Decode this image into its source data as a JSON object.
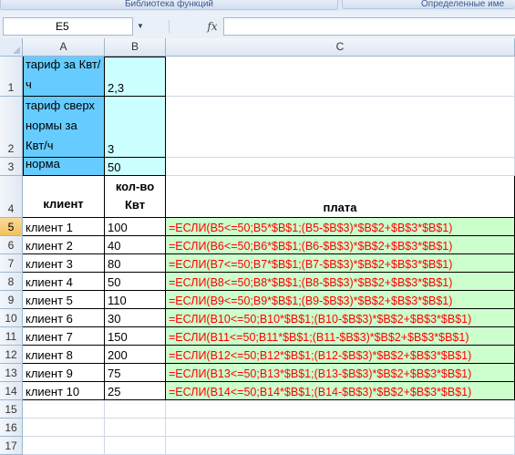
{
  "ribbon": {
    "group1_label": "Библиотека функций",
    "group2_label": "Определенные име"
  },
  "formula_bar": {
    "name_box": "E5",
    "fx_label": "fx",
    "formula_value": ""
  },
  "columns": [
    "A",
    "B",
    "C"
  ],
  "rows": [
    {
      "num": "1",
      "a": "тариф за Квт/ч",
      "b": "2,3",
      "c": ""
    },
    {
      "num": "2",
      "a": "тариф сверх нормы за Квт/ч",
      "b": "3",
      "c": ""
    },
    {
      "num": "3",
      "a": "норма",
      "b": "50",
      "c": ""
    },
    {
      "num": "4",
      "a": "клиент",
      "b": "кол-во Квт",
      "c": "плата"
    },
    {
      "num": "5",
      "a": "клиент 1",
      "b": "100",
      "c": "=ЕСЛИ(B5<=50;B5*$B$1;(B5-$B$3)*$B$2+$B$3*$B$1)"
    },
    {
      "num": "6",
      "a": "клиент 2",
      "b": "40",
      "c": "=ЕСЛИ(B6<=50;B6*$B$1;(B6-$B$3)*$B$2+$B$3*$B$1)"
    },
    {
      "num": "7",
      "a": "клиент 3",
      "b": "80",
      "c": "=ЕСЛИ(B7<=50;B7*$B$1;(B7-$B$3)*$B$2+$B$3*$B$1)"
    },
    {
      "num": "8",
      "a": "клиент 4",
      "b": "50",
      "c": "=ЕСЛИ(B8<=50;B8*$B$1;(B8-$B$3)*$B$2+$B$3*$B$1)"
    },
    {
      "num": "9",
      "a": "клиент 5",
      "b": "110",
      "c": "=ЕСЛИ(B9<=50;B9*$B$1;(B9-$B$3)*$B$2+$B$3*$B$1)"
    },
    {
      "num": "10",
      "a": "клиент 6",
      "b": "30",
      "c": "=ЕСЛИ(B10<=50;B10*$B$1;(B10-$B$3)*$B$2+$B$3*$B$1)"
    },
    {
      "num": "11",
      "a": "клиент 7",
      "b": "150",
      "c": "=ЕСЛИ(B11<=50;B11*$B$1;(B11-$B$3)*$B$2+$B$3*$B$1)"
    },
    {
      "num": "12",
      "a": "клиент 8",
      "b": "200",
      "c": "=ЕСЛИ(B12<=50;B12*$B$1;(B12-$B$3)*$B$2+$B$3*$B$1)"
    },
    {
      "num": "13",
      "a": "клиент 9",
      "b": "75",
      "c": "=ЕСЛИ(B13<=50;B13*$B$1;(B13-$B$3)*$B$2+$B$3*$B$1)"
    },
    {
      "num": "14",
      "a": "клиент 10",
      "b": "25",
      "c": "=ЕСЛИ(B14<=50;B14*$B$1;(B14-$B$3)*$B$2+$B$3*$B$1)"
    },
    {
      "num": "15",
      "a": "",
      "b": "",
      "c": ""
    },
    {
      "num": "16",
      "a": "",
      "b": "",
      "c": ""
    },
    {
      "num": "17",
      "a": "",
      "b": "",
      "c": ""
    }
  ],
  "colors": {
    "param_fill": "#66ccff",
    "value_fill": "#ccffff",
    "formula_fill": "#ccffcc",
    "formula_text": "#ff0000",
    "selected_header": "#f1c15f"
  }
}
